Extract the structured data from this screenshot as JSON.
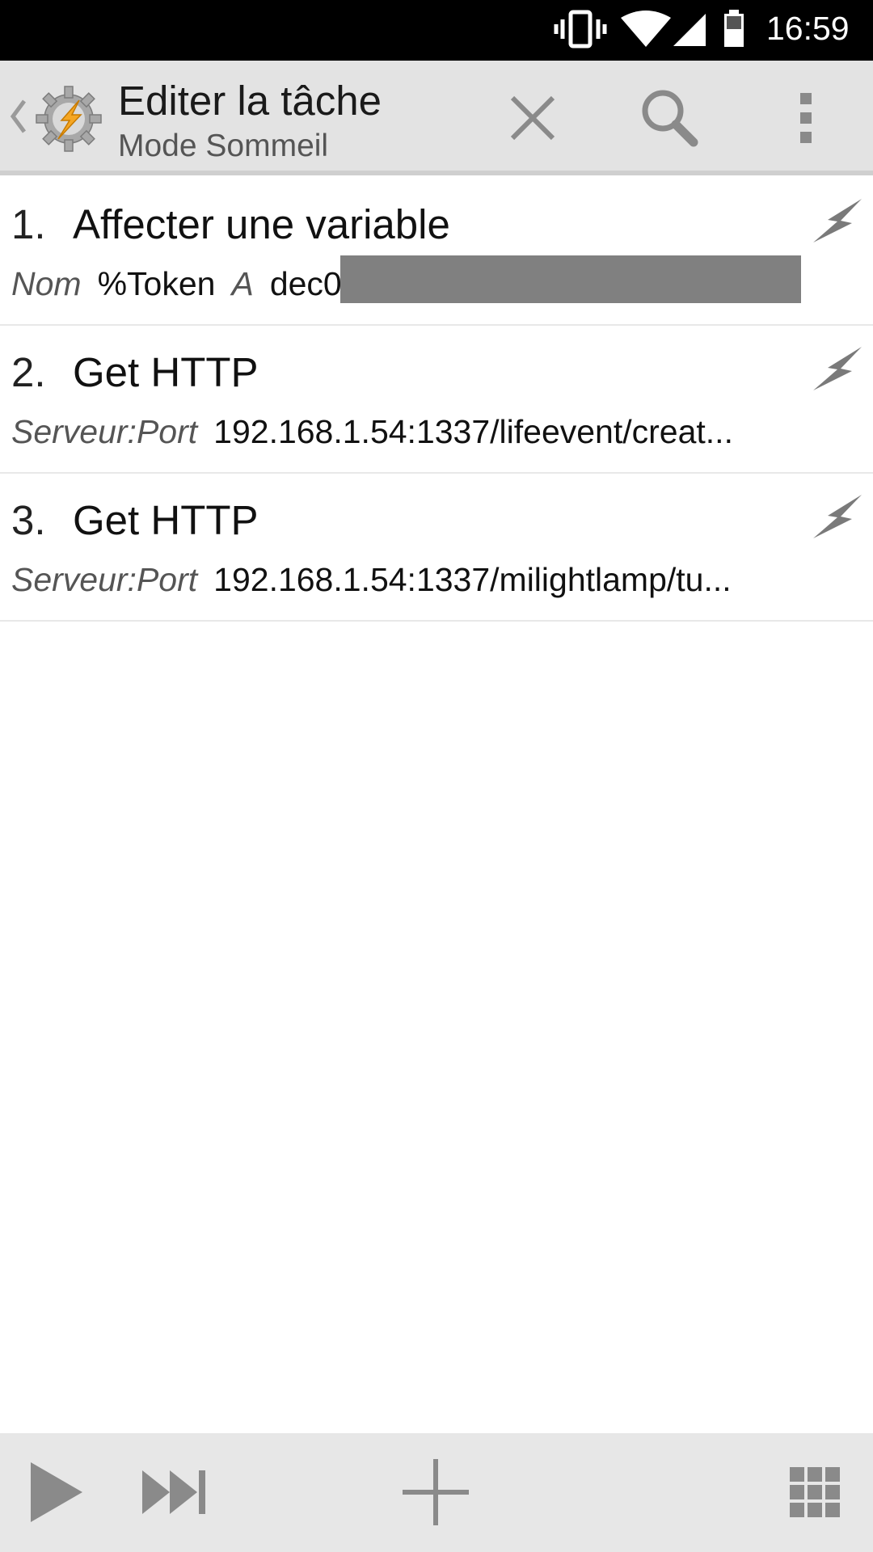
{
  "status_bar": {
    "time": "16:59",
    "icons": [
      "vibrate-icon",
      "wifi-icon",
      "signal-icon",
      "battery-icon"
    ]
  },
  "action_bar": {
    "title": "Editer la tâche",
    "subtitle": "Mode Sommeil",
    "buttons": [
      "close-icon",
      "search-icon",
      "overflow-menu-icon"
    ],
    "app_icon": "tasker-gear-lightning-icon",
    "accent_color": "#f5a623"
  },
  "actions": [
    {
      "number": "1.",
      "name": "Affecter une variable",
      "params": [
        {
          "label": "Nom",
          "value": "%Token"
        },
        {
          "label": "A",
          "value": "dec0"
        }
      ],
      "redacted": true
    },
    {
      "number": "2.",
      "name": "Get HTTP",
      "params": [
        {
          "label": "Serveur:Port",
          "value": "192.168.1.54:1337/lifeevent/creat..."
        }
      ]
    },
    {
      "number": "3.",
      "name": "Get HTTP",
      "params": [
        {
          "label": "Serveur:Port",
          "value": "192.168.1.54:1337/milightlamp/tu..."
        }
      ]
    }
  ],
  "bottom_bar": {
    "buttons": [
      "play-icon",
      "step-forward-icon",
      "add-icon",
      "grid-icon"
    ]
  }
}
